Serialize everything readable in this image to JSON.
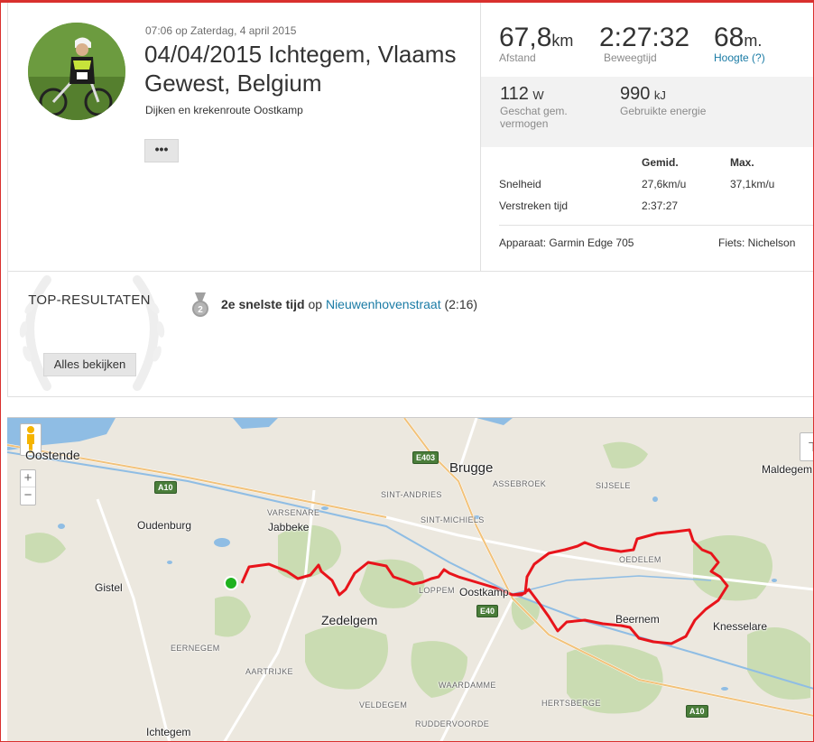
{
  "activity": {
    "datetime": "07:06 op Zaterdag, 4 april 2015",
    "title": "04/04/2015 Ichtegem, Vlaams Gewest, Belgium",
    "subtitle": "Dijken en krekenroute Oostkamp",
    "more_label": "•••"
  },
  "stats": {
    "distance": {
      "value": "67,8",
      "unit": "km",
      "label": "Afstand"
    },
    "moving_time": {
      "value": "2:27:32",
      "label": "Beweegtijd"
    },
    "elevation": {
      "value": "68",
      "unit": "m.",
      "label": "Hoogte (?)"
    },
    "power": {
      "value": "112",
      "unit": "W",
      "label": "Geschat gem. vermogen"
    },
    "energy": {
      "value": "990",
      "unit": "kJ",
      "label": "Gebruikte energie"
    },
    "table": {
      "col_avg": "Gemid.",
      "col_max": "Max.",
      "rows": [
        {
          "label": "Snelheid",
          "avg": "27,6km/u",
          "max": "37,1km/u"
        },
        {
          "label": "Verstreken tijd",
          "avg": "2:37:27",
          "max": ""
        }
      ]
    },
    "device": "Apparaat: Garmin Edge 705",
    "bike": "Fiets: Nichelson"
  },
  "top_results": {
    "title": "TOP-RESULTATEN",
    "button": "Alles bekijken",
    "achievement_rank": "2e snelste tijd",
    "achievement_mid": "op",
    "segment": "Nieuwenhovenstraat",
    "segment_time": "(2:16)",
    "medal_number": "2"
  },
  "map": {
    "labels": {
      "oostende": "Oostende",
      "brugge": "Brugge",
      "maldegem": "Maldegem",
      "oudenburg": "Oudenburg",
      "jabbeke": "Jabbeke",
      "gistel": "Gistel",
      "zedelgem": "Zedelgem",
      "oostkamp": "Oostkamp",
      "beernem": "Beernem",
      "knesselare": "Knesselare",
      "ichtegem": "Ichtegem",
      "sint_andries": "SINT-ANDRIES",
      "varsenare": "VARSENARE",
      "sint_michiels": "SINT-MICHIELS",
      "assebroek": "ASSEBROEK",
      "sijsele": "SIJSELE",
      "oedelem": "OEDELEM",
      "loppem": "LOPPEM",
      "eernegem": "EERNEGEM",
      "aartrijke": "AARTRIJKE",
      "waardamme": "WAARDAMME",
      "veldegem": "VELDEGEM",
      "hertsberge": "HERTSBERGE",
      "ruddervoorde": "RUDDERVOORDE"
    },
    "roads": {
      "e403": "E403",
      "a10_west": "A10",
      "e40": "E40",
      "a10_south": "A10"
    },
    "zoom_in": "+",
    "zoom_out": "−",
    "colors": {
      "route": "#e8141b",
      "start": "#1fb21f",
      "water": "#8fbde4",
      "forest": "#c7d9b0"
    }
  }
}
